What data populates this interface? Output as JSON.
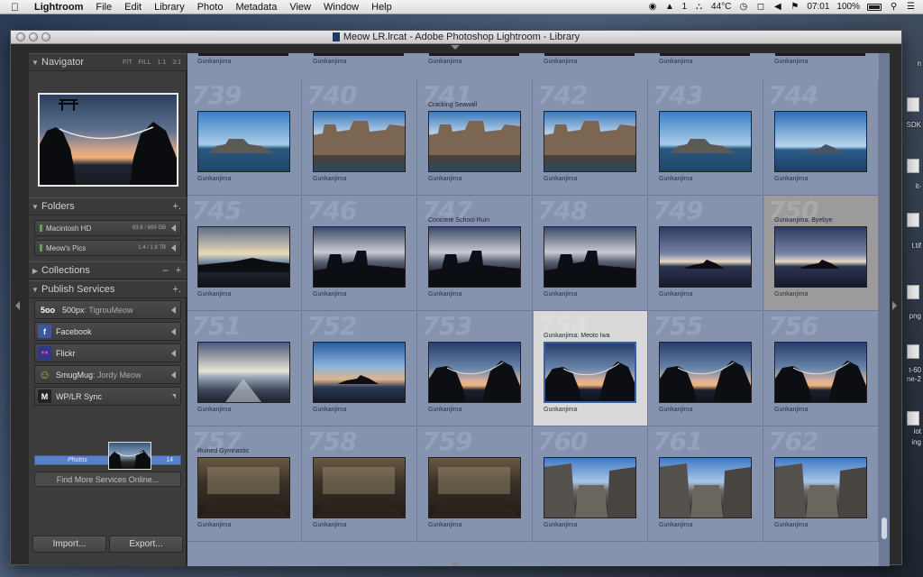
{
  "menubar": {
    "items": [
      "Lightroom",
      "File",
      "Edit",
      "Library",
      "Photo",
      "Metadata",
      "View",
      "Window",
      "Help"
    ],
    "status": {
      "number": "1",
      "temperature": "44°C",
      "time": "07:01",
      "battery": "100%"
    }
  },
  "desktop": {
    "labels": [
      "n",
      "SDK",
      "it-",
      "t.tif",
      "png",
      "t-60",
      "ne-2",
      "iot",
      "ing"
    ]
  },
  "window": {
    "title": "Meow LR.lrcat - Adobe Photoshop Lightroom - Library"
  },
  "left_panel": {
    "navigator": {
      "label": "Navigator",
      "zoom": [
        "FIT",
        "FILL",
        "1:1",
        "3:1"
      ]
    },
    "folders": {
      "label": "Folders",
      "items": [
        {
          "name": "Macintosh HD",
          "capacity": "63.8 / 699 GB"
        },
        {
          "name": "Meow's Pics",
          "capacity": "1.4 / 1.8 TB"
        }
      ]
    },
    "collections": {
      "label": "Collections",
      "minus": "–",
      "plus": "+"
    },
    "publish": {
      "label": "Publish Services",
      "services": [
        {
          "icon": "500px-icon",
          "icon_text": "5oo",
          "name": "500px",
          "sub": ": TigrouMeow"
        },
        {
          "icon": "facebook-icon",
          "icon_text": "f",
          "name": "Facebook",
          "sub": ""
        },
        {
          "icon": "flickr-icon",
          "icon_text": "●●",
          "name": "Flickr",
          "sub": ""
        },
        {
          "icon": "smugmug-icon",
          "icon_text": "☺",
          "name": "SmugMug",
          "sub": ": Jordy Meow"
        },
        {
          "icon": "wplr-icon",
          "icon_text": "M",
          "name": "WP/LR Sync",
          "sub": ""
        }
      ],
      "photos_item": {
        "name": "Photos",
        "count": "14"
      },
      "find_more": "Find More Services Online..."
    },
    "import": "Import...",
    "export": "Export..."
  },
  "grid": {
    "top_partial_captions": [
      "Gunkanjima",
      "Gunkanjima",
      "Gunkanjima",
      "Gunkanjima",
      "Gunkanjima",
      "Gunkanjima"
    ],
    "cells": [
      {
        "num": "739",
        "title": "",
        "caption": "Gunkanjima",
        "style": "normal",
        "scene": "island-day"
      },
      {
        "num": "740",
        "title": "",
        "caption": "Gunkanjima",
        "style": "normal",
        "scene": "ruins-day"
      },
      {
        "num": "741",
        "title": "Cracking Seawall",
        "caption": "Gunkanjima",
        "style": "normal",
        "scene": "ruins-day"
      },
      {
        "num": "742",
        "title": "",
        "caption": "Gunkanjima",
        "style": "normal",
        "scene": "ruins-day"
      },
      {
        "num": "743",
        "title": "",
        "caption": "Gunkanjima",
        "style": "normal",
        "scene": "island-day"
      },
      {
        "num": "744",
        "title": "",
        "caption": "Gunkanjima",
        "style": "normal",
        "scene": "sea-day"
      },
      {
        "num": "745",
        "title": "",
        "caption": "Gunkanjima",
        "style": "normal",
        "scene": "sunset-pier"
      },
      {
        "num": "746",
        "title": "",
        "caption": "Gunkanjima",
        "style": "normal",
        "scene": "sunset-dark"
      },
      {
        "num": "747",
        "title": "Concrete School Ruin",
        "caption": "Gunkanjima",
        "style": "normal",
        "scene": "sunset-dark"
      },
      {
        "num": "748",
        "title": "",
        "caption": "Gunkanjima",
        "style": "normal",
        "scene": "sunset-dark"
      },
      {
        "num": "749",
        "title": "",
        "caption": "Gunkanjima",
        "style": "normal",
        "scene": "sunset-sea"
      },
      {
        "num": "750",
        "title": "Gunkanjima: Byebye",
        "caption": "Gunkanjima",
        "style": "flagged",
        "scene": "sunset-sea"
      },
      {
        "num": "751",
        "title": "",
        "caption": "Gunkanjima",
        "style": "normal",
        "scene": "sunset-bright"
      },
      {
        "num": "752",
        "title": "",
        "caption": "Gunkanjima",
        "style": "normal",
        "scene": "sunset-clouds"
      },
      {
        "num": "753",
        "title": "",
        "caption": "Gunkanjima",
        "style": "normal",
        "scene": "rocks"
      },
      {
        "num": "754",
        "title": "Gunkanjima: Meoto Iwa",
        "caption": "Gunkanjima",
        "style": "selected",
        "scene": "rocks"
      },
      {
        "num": "755",
        "title": "",
        "caption": "Gunkanjima",
        "style": "normal",
        "scene": "rocks"
      },
      {
        "num": "756",
        "title": "",
        "caption": "Gunkanjima",
        "style": "normal",
        "scene": "rocks"
      },
      {
        "num": "757",
        "title": "Ruined Gymnastic",
        "caption": "Gunkanjima",
        "style": "normal",
        "scene": "interior"
      },
      {
        "num": "758",
        "title": "",
        "caption": "Gunkanjima",
        "style": "normal",
        "scene": "interior"
      },
      {
        "num": "759",
        "title": "",
        "caption": "Gunkanjima",
        "style": "normal",
        "scene": "interior"
      },
      {
        "num": "760",
        "title": "",
        "caption": "Gunkanjima",
        "style": "normal",
        "scene": "buildings"
      },
      {
        "num": "761",
        "title": "",
        "caption": "Gunkanjima",
        "style": "normal",
        "scene": "buildings"
      },
      {
        "num": "762",
        "title": "",
        "caption": "Gunkanjima",
        "style": "normal",
        "scene": "buildings"
      }
    ]
  },
  "colors": {
    "grid_bg": "#8593af",
    "panel_bg": "#3c3c3c",
    "selection": "#5a7fc8",
    "flagged": "#9b9b9b"
  }
}
